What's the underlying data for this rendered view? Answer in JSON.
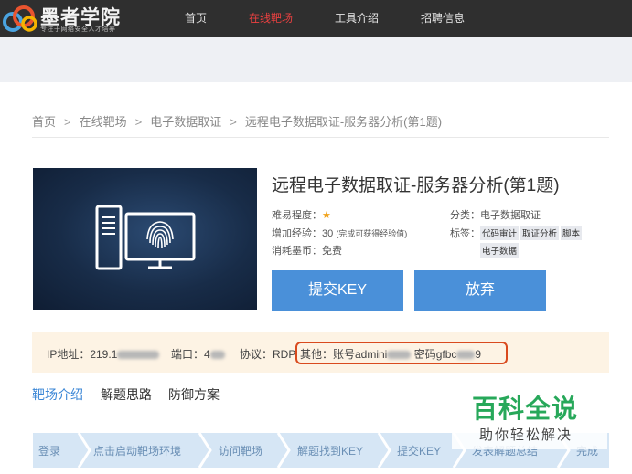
{
  "brand": {
    "name": "墨者学院",
    "slogan": "专注于网络安全人才培养"
  },
  "nav": [
    {
      "label": "首页",
      "active": false
    },
    {
      "label": "在线靶场",
      "active": true
    },
    {
      "label": "工具介绍",
      "active": false
    },
    {
      "label": "招聘信息",
      "active": false
    }
  ],
  "breadcrumb": [
    "首页",
    "在线靶场",
    "电子数据取证",
    "远程电子数据取证-服务器分析(第1题)"
  ],
  "challenge": {
    "title": "远程电子数据取证-服务器分析(第1题)",
    "difficulty_label": "难易程度：",
    "difficulty_stars": "★",
    "exp_label": "增加经验：30",
    "exp_note": "(完成可获得经验值)",
    "cost_label": "消耗墨币：免费",
    "category_label": "分类：电子数据取证",
    "tags_label": "标签：",
    "tags": [
      "代码审计",
      "取证分析",
      "脚本",
      "电子数据"
    ],
    "submit_label": "提交KEY",
    "abandon_label": "放弃"
  },
  "connection": {
    "ip": "IP地址：219.1",
    "port": "端口：4",
    "protocol": "协议：RDP",
    "other_prefix": "其他：账号admini",
    "password_prefix": "密码gfbc",
    "password_suffix": "9"
  },
  "tabs": [
    {
      "label": "靶场介绍",
      "active": true
    },
    {
      "label": "解题思路",
      "active": false
    },
    {
      "label": "防御方案",
      "active": false
    }
  ],
  "steps": [
    "登录",
    "点击启动靶场环境",
    "访问靶场",
    "解题找到KEY",
    "提交KEY",
    "发表解题总结",
    "完成"
  ],
  "watermark": {
    "title": "百科全说",
    "subtitle": "助你轻松解决"
  },
  "colors": {
    "accent": "#4a90d9",
    "nav_active": "#e94040",
    "highlight": "#d94a1e",
    "watermark": "#27a85a"
  }
}
